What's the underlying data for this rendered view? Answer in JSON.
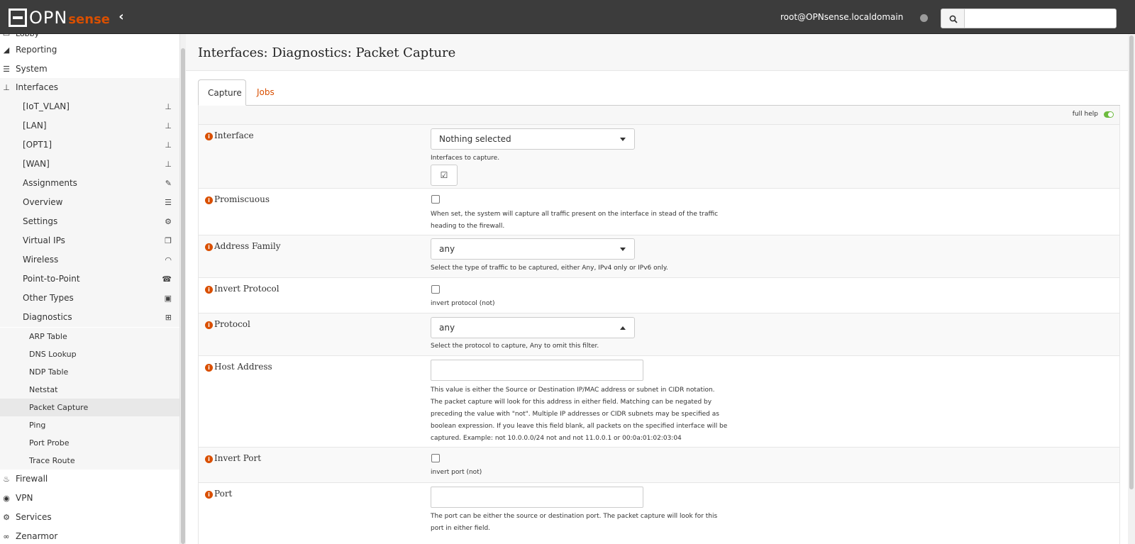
{
  "header": {
    "logo_opn": "OPN",
    "logo_sense": "sense",
    "user": "root@OPNsense.localdomain",
    "search_placeholder": ""
  },
  "sidebar": {
    "top_cut": "Lobby",
    "items": [
      {
        "label": "Reporting",
        "icon": "chart-area-icon"
      },
      {
        "label": "System",
        "icon": "server-icon"
      },
      {
        "label": "Interfaces",
        "icon": "sitemap-icon"
      }
    ],
    "interfaces": [
      {
        "label": "[IoT_VLAN]",
        "icon": "sitemap-icon"
      },
      {
        "label": "[LAN]",
        "icon": "sitemap-icon"
      },
      {
        "label": "[OPT1]",
        "icon": "sitemap-icon"
      },
      {
        "label": "[WAN]",
        "icon": "sitemap-icon"
      },
      {
        "label": "Assignments",
        "icon": "pencil-icon"
      },
      {
        "label": "Overview",
        "icon": "tasks-icon"
      },
      {
        "label": "Settings",
        "icon": "cogs-icon"
      },
      {
        "label": "Virtual IPs",
        "icon": "clone-icon"
      },
      {
        "label": "Wireless",
        "icon": "wifi-icon"
      },
      {
        "label": "Point-to-Point",
        "icon": "tty-icon"
      },
      {
        "label": "Other Types",
        "icon": "archive-icon"
      },
      {
        "label": "Diagnostics",
        "icon": "medkit-icon"
      }
    ],
    "diagnostics": [
      "ARP Table",
      "DNS Lookup",
      "NDP Table",
      "Netstat",
      "Packet Capture",
      "Ping",
      "Port Probe",
      "Trace Route"
    ],
    "bottom": [
      {
        "label": "Firewall",
        "icon": "fire-icon"
      },
      {
        "label": "VPN",
        "icon": "globe-icon"
      },
      {
        "label": "Services",
        "icon": "cog-icon"
      },
      {
        "label": "Zenarmor",
        "icon": "binoculars-icon"
      }
    ]
  },
  "page": {
    "title": "Interfaces: Diagnostics: Packet Capture",
    "tabs": [
      "Capture",
      "Jobs"
    ],
    "full_help": "full help"
  },
  "form": {
    "interface": {
      "label": "Interface",
      "value": "Nothing selected",
      "help": "Interfaces to capture."
    },
    "promiscuous": {
      "label": "Promiscuous",
      "help": "When set, the system will capture all traffic present on the interface in stead of the traffic heading to the firewall."
    },
    "address_family": {
      "label": "Address Family",
      "value": "any",
      "help": "Select the type of traffic to be captured, either Any, IPv4 only or IPv6 only."
    },
    "invert_protocol": {
      "label": "Invert Protocol",
      "help": "invert protocol (not)"
    },
    "protocol": {
      "label": "Protocol",
      "value": "any",
      "help": "Select the protocol to capture, Any to omit this filter."
    },
    "host_address": {
      "label": "Host Address",
      "value": "",
      "help": "This value is either the Source or Destination IP/MAC address or subnet in CIDR notation. The packet capture will look for this address in either field. Matching can be negated by preceding the value with \"not\". Multiple IP addresses or CIDR subnets may be specified as boolean expression. If you leave this field blank, all packets on the specified interface will be captured. Example: not 10.0.0.0/24 not and not 11.0.0.1 or 00:0a:01:02:03:04"
    },
    "invert_port": {
      "label": "Invert Port",
      "help": "invert port (not)"
    },
    "port": {
      "label": "Port",
      "value": "",
      "help": "The port can be either the source or destination port. The packet capture will look for this port in either field."
    }
  }
}
